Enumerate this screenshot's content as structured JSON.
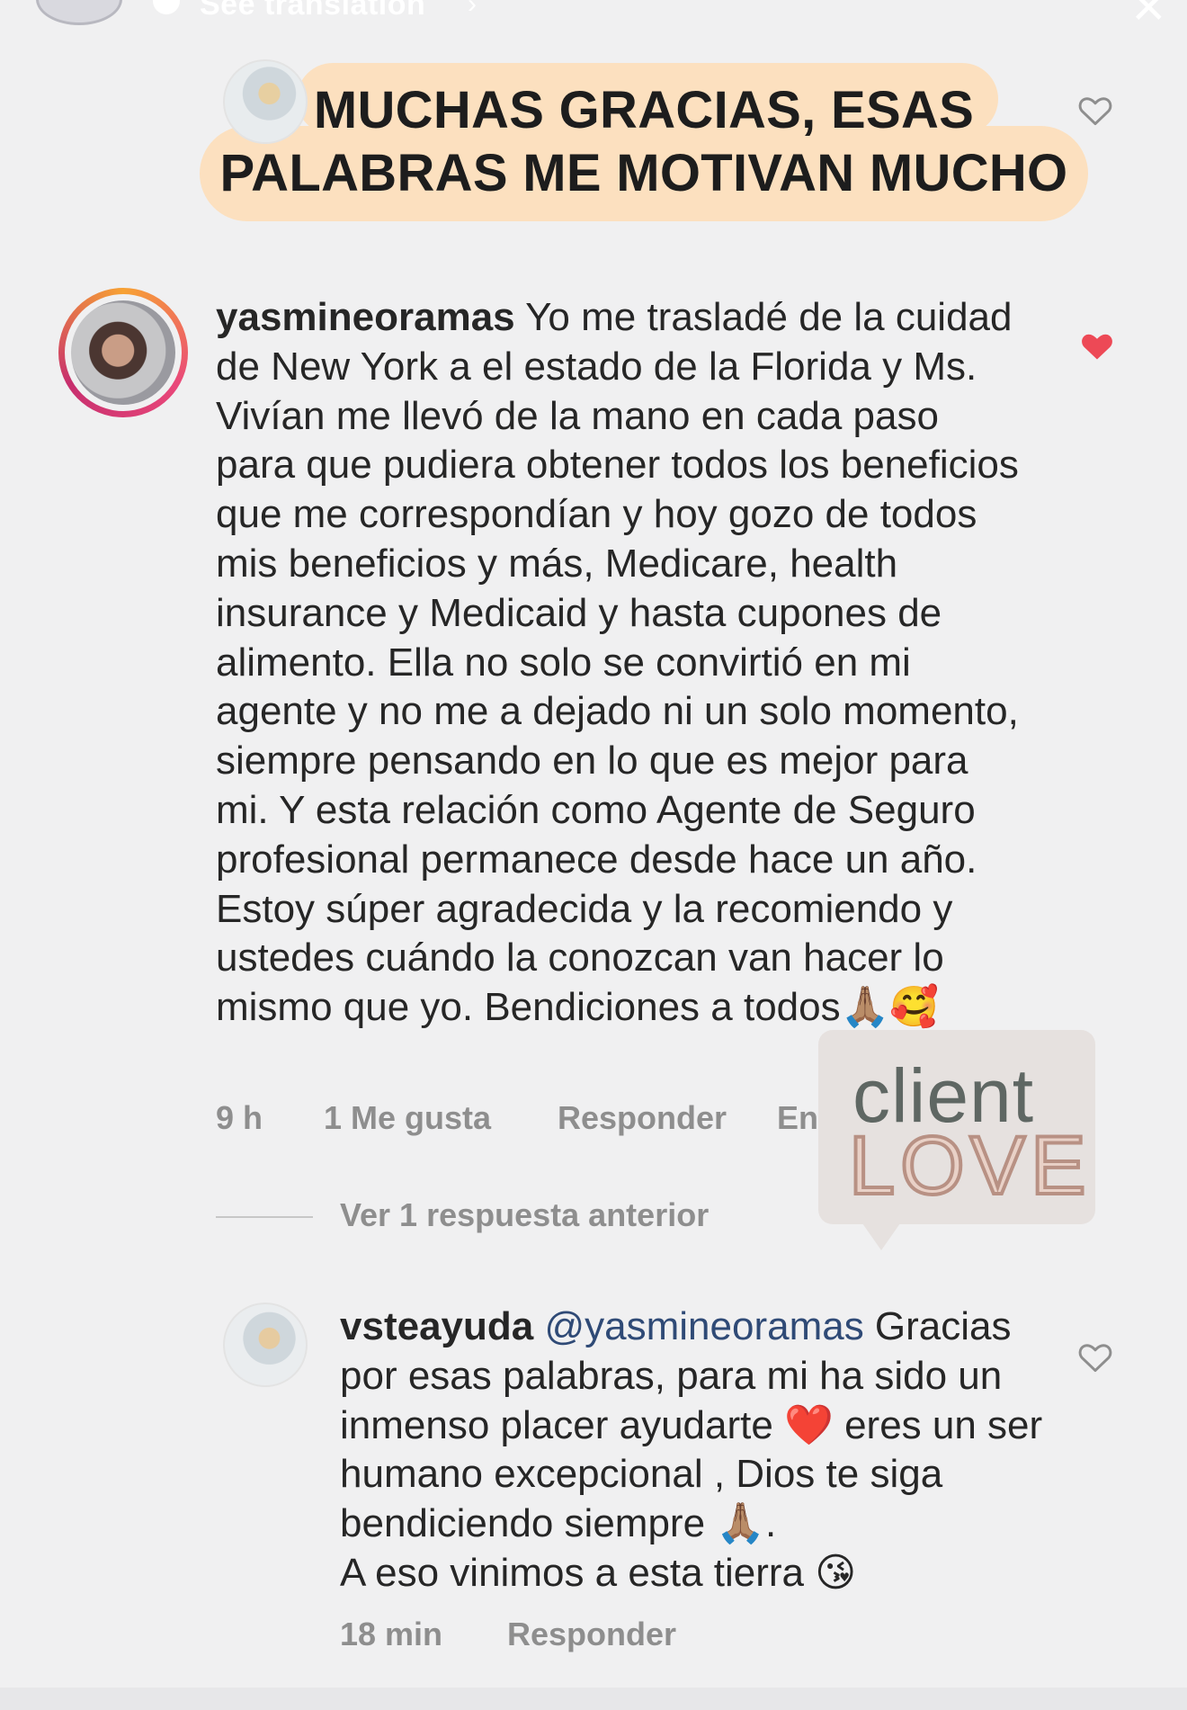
{
  "top": {
    "translation_label": "See translation"
  },
  "quote": {
    "text": "MUCHAS GRACIAS, ESAS PALABRAS ME MOTIVAN MUCHO"
  },
  "main_comment": {
    "username": "yasmineoramas",
    "text": " Yo me trasladé de la cuidad de New York a el estado de la Florida y Ms. Vivían me llevó de la mano en cada paso para que pudiera obtener todos los beneficios que me correspondían y hoy gozo de todos mis beneficios y más, Medicare, health insurance y Medicaid y hasta cupones de alimento. Ella no solo se convirtió en mi agente y no me a dejado ni un solo momento, siempre pensando en lo que es mejor para mi. Y esta relación como Agente de Seguro profesional permanece desde hace un año. Estoy súper agradecida y la recomiendo y ustedes cuándo la conozcan van hacer lo mismo que yo. Bendiciones a todos🙏🏽🥰",
    "time": "9 h",
    "likes": "1 Me gusta",
    "reply_label": "Responder",
    "translate_label": "En",
    "liked": true
  },
  "view_replies": "Ver 1 respuesta anterior",
  "sticker": {
    "line1": "client",
    "line2": "LOVE"
  },
  "reply_comment": {
    "username": "vsteayuda",
    "mention": "@yasmineoramas",
    "text": " Gracias por esas palabras, para mi ha sido un inmenso placer ayudarte ❤️ eres un ser humano excepcional , Dios te siga bendiciendo siempre 🙏🏽.\nA eso vinimos a esta tierra 😘",
    "time": "18 min",
    "reply_label": "Responder"
  },
  "colors": {
    "accent_heart": "#ed4956",
    "quote_bubble": "#fce0bf",
    "meta_gray": "#8e8e8e"
  }
}
